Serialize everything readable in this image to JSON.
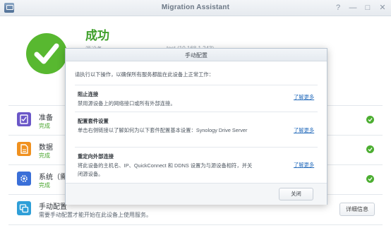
{
  "window": {
    "title": "Migration Assistant",
    "controls": [
      "?",
      "—",
      "□",
      "✕"
    ]
  },
  "result": {
    "heading": "成功",
    "faded_left": "源设备",
    "faded_right": "test (10.168.1.243)"
  },
  "steps": [
    {
      "name": "准备",
      "status": "完成",
      "icon": "checklist-icon",
      "color": "#6b57c8"
    },
    {
      "name": "数据",
      "status": "完成",
      "icon": "document-icon",
      "color": "#f0911f"
    },
    {
      "name": "系统（需",
      "status": "完成",
      "icon": "gear-icon",
      "color": "#3a6fd8"
    },
    {
      "name": "手动配置",
      "description": "需要手动配置才能开始在此设备上使用服务。",
      "icon": "config-icon",
      "color": "#2f9fd8",
      "button": "详细信息"
    }
  ],
  "dialog": {
    "title": "手动配置",
    "intro": "请执行以下操作，以确保所有服务都能在此设备上正常工作：",
    "items": [
      {
        "title": "阻止连接",
        "text": "禁用源设备上的网络接口或所有外部连接。",
        "link": "了解更多"
      },
      {
        "title": "配置套件设置",
        "text": "单击右侧链接以了解如何为以下套件配置基本设置：Synology Drive Server",
        "link": "了解更多"
      },
      {
        "title": "重定向外部连接",
        "text": "将此设备的主机名、IP、QuickConnect 和 DDNS 设置为与源设备相符，并关闭源设备。",
        "link": "了解更多"
      }
    ],
    "close_label": "关闭"
  }
}
